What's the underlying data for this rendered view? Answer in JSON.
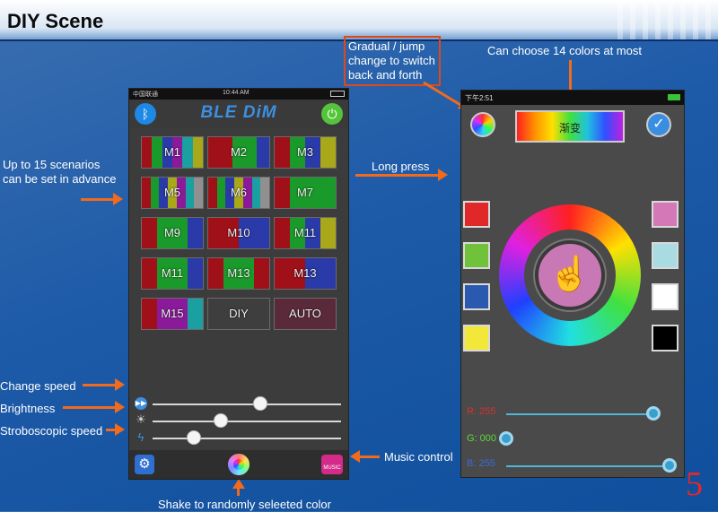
{
  "header": {
    "title": "DIY Scene"
  },
  "page_number": "5",
  "annotations": {
    "scenarios": "Up to 15 scenarios\ncan be set in advance",
    "change_speed": "Change speed",
    "brightness": "Brightness",
    "strobe_speed": "Stroboscopic speed",
    "music_control": "Music control",
    "shake": "Shake to randomly seleeted color",
    "gradual": "Gradual / jump\nchange to switch\nback and forth",
    "colors": "Can choose 14 colors at most",
    "long_press": "Long press"
  },
  "phone1": {
    "status_carrier": "中国联通",
    "status_time": "10:44 AM",
    "app_title": "BLE DiM",
    "scenes": [
      {
        "label": "M1",
        "stripes": [
          "#a01018",
          "#1a9a2a",
          "#2a3aa8",
          "#8a1a9a",
          "#1aa0a0",
          "#a8a818"
        ]
      },
      {
        "label": "M2",
        "stripes": [
          "#a01018",
          "#a01018",
          "#1a9a2a",
          "#1a9a2a",
          "#2a3aa8"
        ]
      },
      {
        "label": "M3",
        "stripes": [
          "#a01018",
          "#1a9a2a",
          "#2a3aa8",
          "#a8a818"
        ]
      },
      {
        "label": "M5",
        "stripes": [
          "#a01018",
          "#1a9a2a",
          "#2a3aa8",
          "#a8a818",
          "#8a1a9a",
          "#1aa0a0",
          "#909090"
        ]
      },
      {
        "label": "M6",
        "stripes": [
          "#a01018",
          "#1a9a2a",
          "#2a3aa8",
          "#a8a818",
          "#8a1a9a",
          "#1aa0a0",
          "#909090"
        ]
      },
      {
        "label": "M7",
        "stripes": [
          "#a01018",
          "#1a9a2a",
          "#1a9a2a",
          "#1a9a2a"
        ]
      },
      {
        "label": "M9",
        "stripes": [
          "#a01018",
          "#1a9a2a",
          "#1a9a2a",
          "#2a3aa8"
        ]
      },
      {
        "label": "M10",
        "stripes": [
          "#a01018",
          "#a01018",
          "#2a3aa8",
          "#2a3aa8"
        ]
      },
      {
        "label": "M11",
        "stripes": [
          "#a01018",
          "#1a9a2a",
          "#2a3aa8",
          "#a8a818"
        ]
      },
      {
        "label": "M11",
        "stripes": [
          "#a01018",
          "#1a9a2a",
          "#1a9a2a",
          "#2a3aa8"
        ]
      },
      {
        "label": "M13",
        "stripes": [
          "#a01018",
          "#1a9a2a",
          "#1a9a2a",
          "#a01018"
        ]
      },
      {
        "label": "M13",
        "stripes": [
          "#a01018",
          "#a01018",
          "#2a3aa8",
          "#2a3aa8"
        ]
      },
      {
        "label": "M15",
        "stripes": [
          "#a01018",
          "#8a1a9a",
          "#8a1a9a",
          "#1aa0a0"
        ]
      },
      {
        "label": "DIY",
        "stripes": [
          "#3e3e3e"
        ]
      },
      {
        "label": "AUTO",
        "stripes": [
          "#5a2a3a"
        ]
      }
    ],
    "sliders": {
      "speed": 0.57,
      "brightness": 0.36,
      "strobe": 0.22
    },
    "music_label": "MUSIC"
  },
  "phone2": {
    "status_time": "下午2:51",
    "gradient_label": "渐变",
    "left_swatches": [
      "#e02828",
      "#6fc23a",
      "#2a5ab0",
      "#f2e83a"
    ],
    "right_swatches": [
      "#d478b8",
      "#a8dce0",
      "#ffffff",
      "#000000"
    ],
    "rgb": {
      "r_label": "R: 255",
      "r_value": 1.0,
      "g_label": "G: 000",
      "g_value": 0.0,
      "b_label": "B: 255",
      "b_value": 1.0
    },
    "colors": {
      "r": "#d83030",
      "g": "#5cd83a",
      "b": "#3a6ad8"
    }
  }
}
